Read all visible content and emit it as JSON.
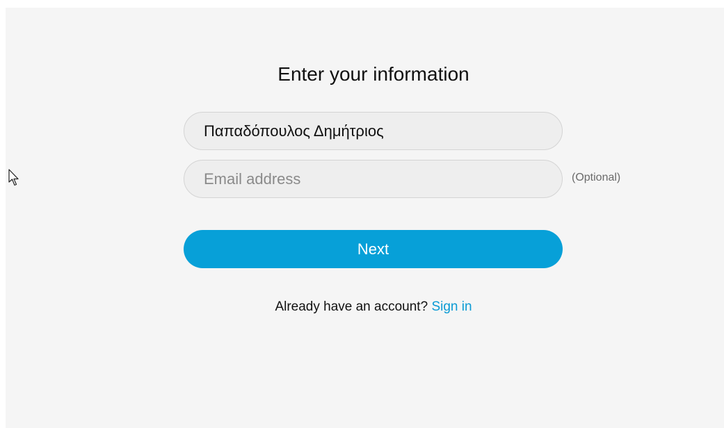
{
  "form": {
    "title": "Enter your information",
    "name_value": "Παπαδόπουλος Δημήτριος",
    "email_placeholder": "Email address",
    "email_optional_label": "(Optional)",
    "next_label": "Next",
    "signin_prompt": "Already have an account?",
    "signin_link": "Sign in"
  },
  "colors": {
    "background": "#f5f5f5",
    "primary_button": "#07a0d8",
    "link": "#0a9ad4"
  },
  "icons": {
    "cursor": "mouse-pointer-icon"
  }
}
